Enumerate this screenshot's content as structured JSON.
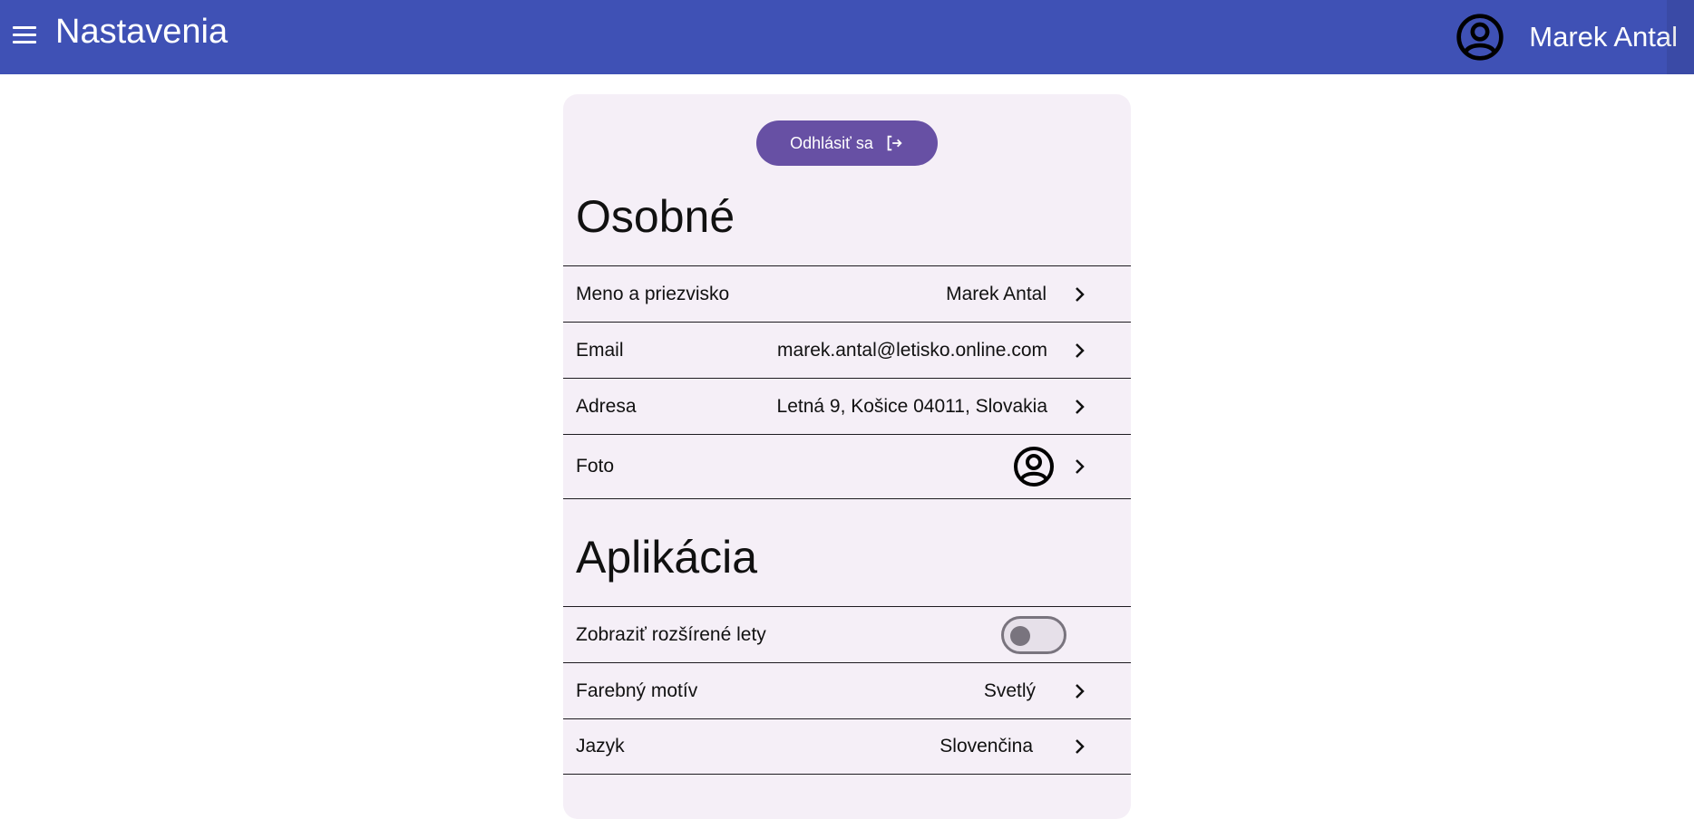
{
  "header": {
    "title": "Nastavenia",
    "user_name": "Marek Antal",
    "icons": {
      "menu": "menu-icon",
      "avatar": "account-circle-icon"
    }
  },
  "logout": {
    "label": "Odhlásiť sa",
    "icon": "logout-icon"
  },
  "personal": {
    "title": "Osobné",
    "rows": [
      {
        "label": "Meno a priezvisko",
        "value": "Marek Antal"
      },
      {
        "label": "Email",
        "value": "marek.antal@letisko.online.com"
      },
      {
        "label": "Adresa",
        "value": "Letná 9, Košice 04011, Slovakia"
      },
      {
        "label": "Foto",
        "value_icon": "account-circle-icon"
      }
    ]
  },
  "app": {
    "title": "Aplikácia",
    "rows": [
      {
        "label": "Zobraziť rozšírené lety",
        "toggle": false
      },
      {
        "label": "Farebný motív",
        "value": "Svetlý"
      },
      {
        "label": "Jazyk",
        "value": "Slovenčina"
      }
    ]
  },
  "colors": {
    "primary": "#3f51b5",
    "button": "#6750a4",
    "card": "#f5eff7"
  }
}
